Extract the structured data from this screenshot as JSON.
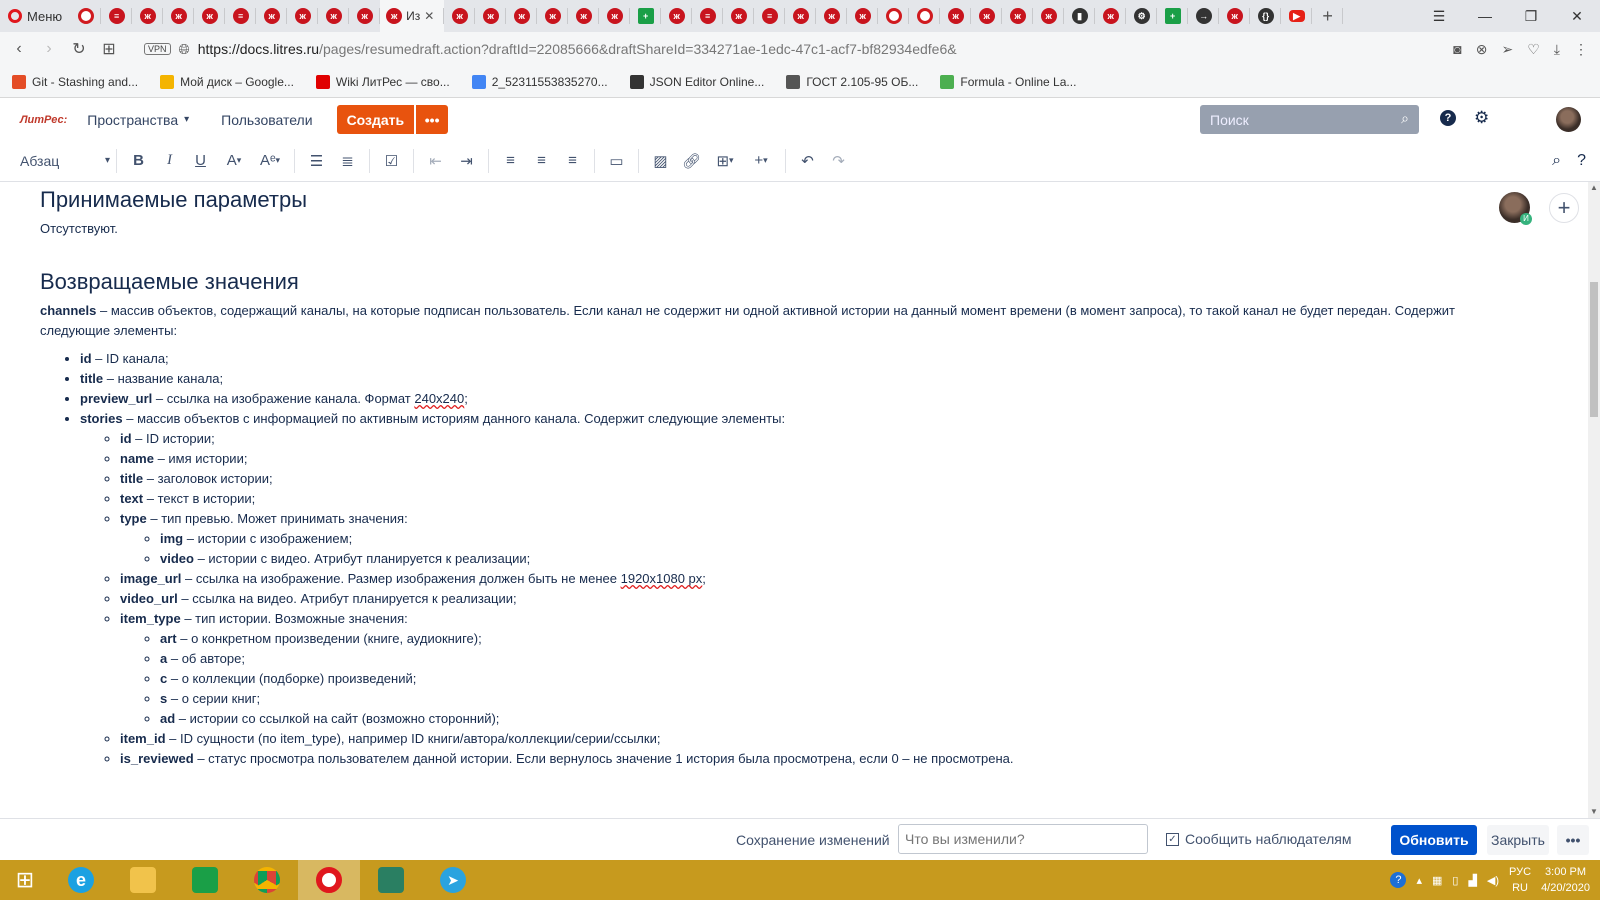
{
  "browser": {
    "menu_label": "Меню",
    "active_tab_label": "Из",
    "url_host": "https://docs.litres.ru",
    "url_path": "/pages/resumedraft.action?draftId=22085666&draftShareId=334271ae-1edc-47c1-acf7-bf82934edfe6&",
    "vpn_label": "VPN",
    "bookmarks": [
      {
        "label": "Git - Stashing and...",
        "color": "#e44d26"
      },
      {
        "label": "Мой диск – Google...",
        "color": "#f4b400"
      },
      {
        "label": "Wiki ЛитРес — сво...",
        "color": "#e00000"
      },
      {
        "label": "2_52311553835270...",
        "color": "#4285f4"
      },
      {
        "label": "JSON Editor Online...",
        "color": "#333333"
      },
      {
        "label": "ГОСТ 2.105-95 ОБ...",
        "color": "#555555"
      },
      {
        "label": "Formula - Online La...",
        "color": "#4caf50"
      }
    ]
  },
  "appbar": {
    "logo": "ЛитРес:",
    "spaces": "Пространства",
    "users": "Пользователи",
    "create": "Создать",
    "more": "•••",
    "search_placeholder": "Поиск"
  },
  "editor_toolbar": {
    "paragraph_style": "Абзац"
  },
  "doc": {
    "h_params": "Принимаемые параметры",
    "params_text": "Отсутствуют.",
    "h_returns": "Возвращаемые значения",
    "channels_key": "channels",
    "channels_desc": " – массив объектов, содержащий каналы, на которые подписан пользователь. Если канал не содержит ни одной активной истории на данный момент времени (в момент запроса), то такой канал не будет передан. Содержит следующие элементы:",
    "items": [
      {
        "key": "id",
        "desc": " – ID канала;"
      },
      {
        "key": "title",
        "desc": " – название канала;"
      },
      {
        "key": "preview_url",
        "desc": " – ссылка на изображение канала. Формат ",
        "tail": "240x240",
        "end": ";"
      },
      {
        "key": "stories",
        "desc": " – массив объектов с информацией по активным историям данного канала. Содержит следующие элементы:"
      }
    ],
    "story_items": [
      {
        "key": "id",
        "desc": " – ID истории;"
      },
      {
        "key": "name",
        "desc": " – имя истории;"
      },
      {
        "key": "title",
        "desc": " – заголовок истории;"
      },
      {
        "key": "text",
        "desc": " – текст в истории;"
      },
      {
        "key": "type",
        "desc": " – тип превью. Может принимать значения:"
      }
    ],
    "type_values": [
      {
        "key": "img",
        "desc": " – истории с изображением;"
      },
      {
        "key": "video",
        "desc": " – истории с видео. Атрибут планируется к реализации;"
      }
    ],
    "story_items2": [
      {
        "key": "image_url",
        "desc": " – ссылка на изображение. Размер изображения должен быть не менее ",
        "tail": "1920x1080 px",
        "end": ";"
      },
      {
        "key": "video_url",
        "desc": " – ссылка на видео. Атрибут планируется к реализации;"
      },
      {
        "key": "item_type",
        "desc": " – тип истории. Возможные значения:"
      }
    ],
    "item_type_values": [
      {
        "key": "art",
        "desc": " – о конкретном произведении (книге, аудиокниге);"
      },
      {
        "key": "a",
        "desc": " – об авторе;"
      },
      {
        "key": "c",
        "desc": " – о коллекции (подборке) произведений;"
      },
      {
        "key": "s",
        "desc": " – о серии книг;"
      },
      {
        "key": "ad",
        "desc": " – истории со ссылкой на сайт (возможно сторонний);"
      }
    ],
    "story_items3": [
      {
        "key": "item_id",
        "desc": " – ID сущности (по item_type), например ID книги/автора/коллекции/серии/ссылки;"
      },
      {
        "key": "is_reviewed",
        "desc": " – статус просмотра пользователем данной истории. Если вернулось значение 1 история была просмотрена, если 0 – не просмотрена."
      }
    ]
  },
  "collab": {
    "badge": "И"
  },
  "bottombar": {
    "save_label": "Сохранение изменений",
    "comment_placeholder": "Что вы изменили?",
    "notify_label": "Сообщить наблюдателям",
    "update": "Обновить",
    "close": "Закрыть",
    "more": "•••"
  },
  "taskbar": {
    "lang": "РУС",
    "lang2": "RU",
    "time": "3:00 PM",
    "date": "4/20/2020"
  }
}
